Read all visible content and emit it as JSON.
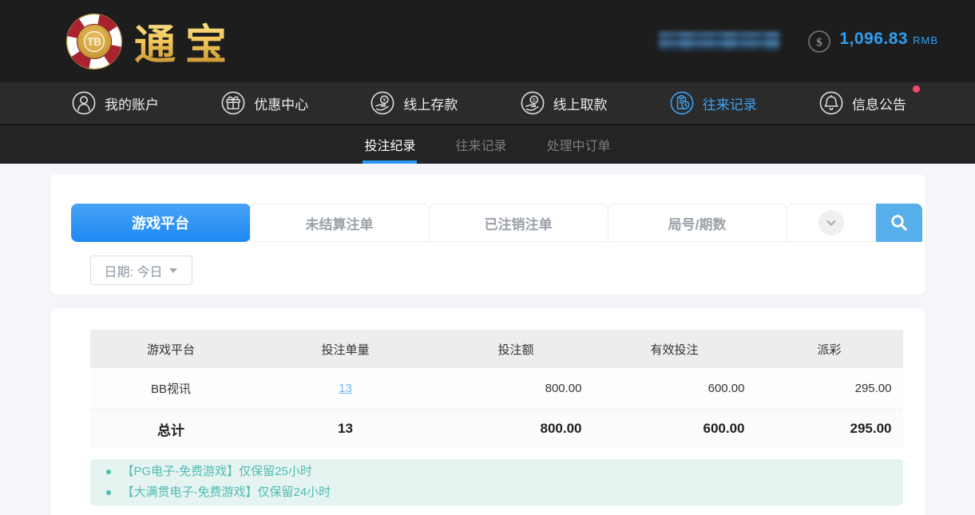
{
  "header": {
    "logo_badge": "TB",
    "logo_text": "通宝",
    "balance_value": "1,096.83",
    "balance_currency": "RMB"
  },
  "nav": {
    "items": [
      {
        "label": "我的账户",
        "icon": "user-icon",
        "active": false
      },
      {
        "label": "优惠中心",
        "icon": "gift-icon",
        "active": false
      },
      {
        "label": "线上存款",
        "icon": "deposit-icon",
        "active": false
      },
      {
        "label": "线上取款",
        "icon": "withdraw-icon",
        "active": false
      },
      {
        "label": "往来记录",
        "icon": "records-icon",
        "active": true
      },
      {
        "label": "信息公告",
        "icon": "bell-icon",
        "active": false,
        "has_badge": true
      }
    ]
  },
  "subnav": {
    "tabs": [
      {
        "label": "投注纪录",
        "active": true
      },
      {
        "label": "往来记录",
        "active": false
      },
      {
        "label": "处理中订单",
        "active": false
      }
    ]
  },
  "filter": {
    "tabs": [
      {
        "label": "游戏平台",
        "active": true
      },
      {
        "label": "未结算注单",
        "active": false
      },
      {
        "label": "已注销注单",
        "active": false
      },
      {
        "label": "局号/期数",
        "active": false
      }
    ],
    "dropdown_icon": "chevron-down-icon",
    "search_icon": "search-icon",
    "date_label": "日期: 今日"
  },
  "table": {
    "headers": [
      "游戏平台",
      "投注单量",
      "投注额",
      "有效投注",
      "派彩"
    ],
    "rows": [
      {
        "platform": "BB视讯",
        "count": "13",
        "bet_amount": "800.00",
        "valid_bet": "600.00",
        "payout": "295.00"
      }
    ],
    "total": {
      "label": "总计",
      "count": "13",
      "bet_amount": "800.00",
      "valid_bet": "600.00",
      "payout": "295.00"
    }
  },
  "notes": [
    "【PG电子-免费游戏】仅保留25小时",
    "【大满贯电子-免费游戏】仅保留24小时"
  ],
  "colors": {
    "accent_blue": "#3da0f0",
    "tab_gradient_top": "#47a3f6",
    "tab_gradient_bottom": "#1f88f2",
    "search_button_blue": "#56aeea",
    "link_blue": "#6db9f3",
    "notice_teal": "#4fbcb0",
    "badge_red": "#f4476c",
    "balance_blue": "#2f9ff3"
  }
}
